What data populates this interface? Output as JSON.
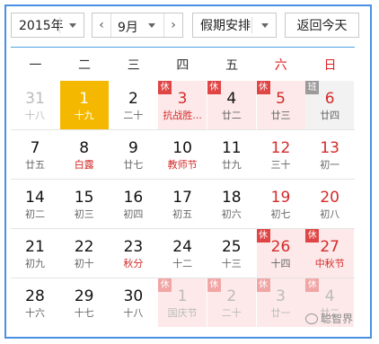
{
  "toolbar": {
    "year_value": "2015年",
    "month_prev": "‹",
    "month_value": "9月",
    "month_next": "›",
    "holiday_value": "假期安排",
    "today_label": "返回今天"
  },
  "weekdays": [
    "一",
    "二",
    "三",
    "四",
    "五",
    "六",
    "日"
  ],
  "accent_colors": {
    "selected": "#f5b800",
    "holiday_red": "#d42a2a",
    "border_blue": "#4a90e2",
    "rest_bg": "#fde9e9"
  },
  "weeks": [
    [
      {
        "day": "31",
        "sub": "十八",
        "off": true
      },
      {
        "day": "1",
        "sub": "十九",
        "selected": true
      },
      {
        "day": "2",
        "sub": "二十"
      },
      {
        "day": "3",
        "sub": "抗战胜...",
        "badge": "休",
        "rest": true,
        "red": true,
        "subred": true
      },
      {
        "day": "4",
        "sub": "廿二",
        "badge": "休",
        "rest": true
      },
      {
        "day": "5",
        "sub": "廿三",
        "badge": "休",
        "rest": true,
        "red": true
      },
      {
        "day": "6",
        "sub": "廿四",
        "badge": "班",
        "work": true,
        "red": true
      }
    ],
    [
      {
        "day": "7",
        "sub": "廿五"
      },
      {
        "day": "8",
        "sub": "白露",
        "subred": true
      },
      {
        "day": "9",
        "sub": "廿七"
      },
      {
        "day": "10",
        "sub": "教师节",
        "subred": true
      },
      {
        "day": "11",
        "sub": "廿九"
      },
      {
        "day": "12",
        "sub": "三十",
        "red": true
      },
      {
        "day": "13",
        "sub": "初一",
        "red": true
      }
    ],
    [
      {
        "day": "14",
        "sub": "初二"
      },
      {
        "day": "15",
        "sub": "初三"
      },
      {
        "day": "16",
        "sub": "初四"
      },
      {
        "day": "17",
        "sub": "初五"
      },
      {
        "day": "18",
        "sub": "初六"
      },
      {
        "day": "19",
        "sub": "初七",
        "red": true
      },
      {
        "day": "20",
        "sub": "初八",
        "red": true
      }
    ],
    [
      {
        "day": "21",
        "sub": "初九"
      },
      {
        "day": "22",
        "sub": "初十"
      },
      {
        "day": "23",
        "sub": "秋分",
        "subred": true
      },
      {
        "day": "24",
        "sub": "十二"
      },
      {
        "day": "25",
        "sub": "十三"
      },
      {
        "day": "26",
        "sub": "十四",
        "badge": "休",
        "rest": true,
        "red": true
      },
      {
        "day": "27",
        "sub": "中秋节",
        "badge": "休",
        "rest": true,
        "red": true,
        "subred": true
      }
    ],
    [
      {
        "day": "28",
        "sub": "十六"
      },
      {
        "day": "29",
        "sub": "十七"
      },
      {
        "day": "30",
        "sub": "十八"
      },
      {
        "day": "1",
        "sub": "国庆节",
        "badge": "休",
        "rest": true,
        "off": true
      },
      {
        "day": "2",
        "sub": "二十",
        "badge": "休",
        "rest": true,
        "off": true
      },
      {
        "day": "3",
        "sub": "廿一",
        "badge": "休",
        "rest": true,
        "off": true
      },
      {
        "day": "4",
        "sub": "廿二",
        "badge": "休",
        "rest": true,
        "off": true
      }
    ]
  ],
  "watermark": {
    "text": "聪智界"
  }
}
